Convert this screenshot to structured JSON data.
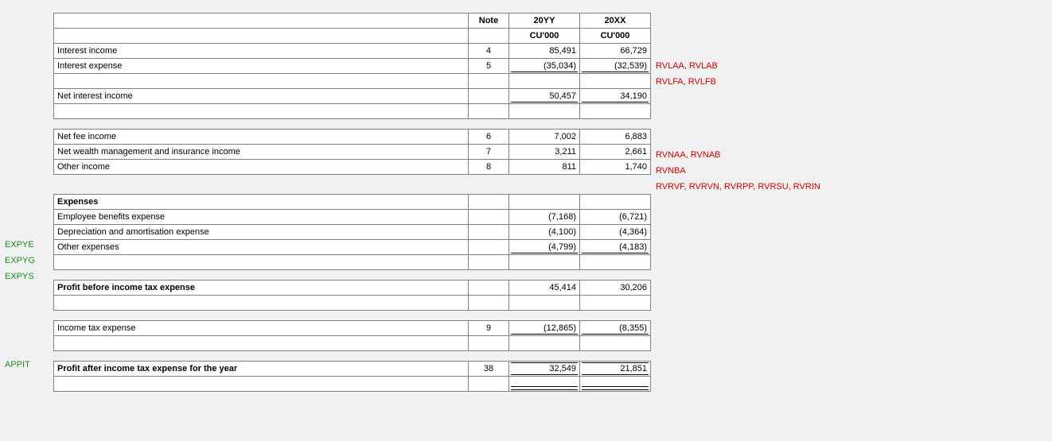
{
  "headers": {
    "note": "Note",
    "col_yy": "20YY",
    "col_xx": "20XX",
    "unit_yy": "CU'000",
    "unit_xx": "CU'000"
  },
  "rows": {
    "interest_income": {
      "label": "Interest income",
      "note": "4",
      "yy": "85,491",
      "xx": "66,729",
      "right": "RVLAA, RVLAB"
    },
    "interest_expense": {
      "label": "Interest expense",
      "note": "5",
      "yy": "(35,034)",
      "xx": "(32,539)",
      "right": "RVLFA, RVLFB"
    },
    "net_interest_income": {
      "label": "Net interest income",
      "note": "",
      "yy": "50,457",
      "xx": "34,190"
    },
    "net_fee_income": {
      "label": "Net fee income",
      "note": "6",
      "yy": "7,002",
      "xx": "6,883",
      "right": "RVNAA, RVNAB"
    },
    "net_wealth": {
      "label": "Net wealth management and insurance income",
      "note": "7",
      "yy": "3,211",
      "xx": "2,661",
      "right": "RVNBA"
    },
    "other_income": {
      "label": "Other income",
      "note": "8",
      "yy": "811",
      "xx": "1,740",
      "right": "RVRVF, RVRVN, RVRPP, RVRSU, RVRIN"
    },
    "expenses_hdr": {
      "label": "Expenses"
    },
    "employee_benefits": {
      "label": "Employee benefits expense",
      "note": "",
      "yy": "(7,168)",
      "xx": "(6,721)",
      "left": "EXPYE"
    },
    "depreciation": {
      "label": "Depreciation and amortisation expense",
      "note": "",
      "yy": "(4,100)",
      "xx": "(4,364)",
      "left": "EXPYG"
    },
    "other_expenses": {
      "label": "Other expenses",
      "note": "",
      "yy": "(4,799)",
      "xx": "(4,183)",
      "left": "EXPYS"
    },
    "profit_before_tax": {
      "label": "Profit before income tax expense",
      "note": "",
      "yy": "45,414",
      "xx": "30,206"
    },
    "income_tax": {
      "label": "Income tax expense",
      "note": "9",
      "yy": "(12,865)",
      "xx": "(8,355)",
      "left": "APPIT"
    },
    "profit_after_tax": {
      "label": "Profit after income tax expense for the year",
      "note": "38",
      "yy": "32,549",
      "xx": "21,851"
    }
  }
}
